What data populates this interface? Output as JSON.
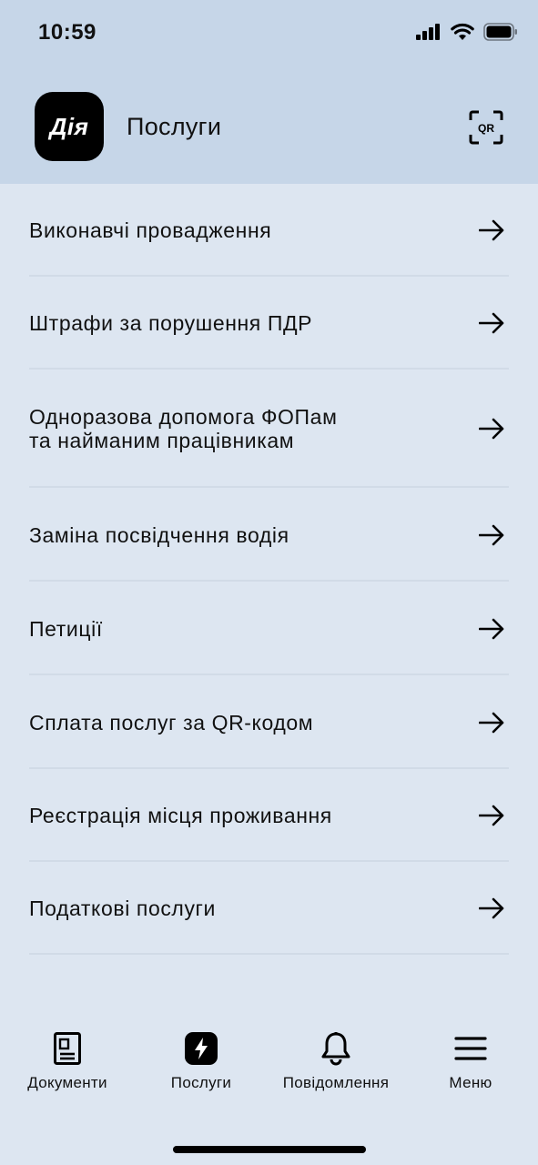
{
  "status_bar": {
    "time": "10:59",
    "icons": [
      "cellular-signal-icon",
      "wifi-icon",
      "battery-icon"
    ]
  },
  "header": {
    "logo_text": "Дія",
    "title": "Послуги",
    "qr_label": "QR"
  },
  "services": [
    {
      "label": "Виконавчі провадження"
    },
    {
      "label": "Штрафи за порушення ПДР"
    },
    {
      "label": "Одноразова допомога ФОПам\nта найманим працівникам"
    },
    {
      "label": "Заміна посвідчення водія"
    },
    {
      "label": "Петиції"
    },
    {
      "label": "Сплата послуг за QR-кодом"
    },
    {
      "label": "Реєстрація місця проживання"
    },
    {
      "label": "Податкові послуги"
    }
  ],
  "tabs": [
    {
      "label": "Документи",
      "icon": "document-icon",
      "active": false
    },
    {
      "label": "Послуги",
      "icon": "lightning-icon",
      "active": true
    },
    {
      "label": "Повідомлення",
      "icon": "bell-icon",
      "active": false
    },
    {
      "label": "Меню",
      "icon": "menu-icon",
      "active": false
    }
  ],
  "colors": {
    "header_bg": "#c6d6e8",
    "page_bg": "#dde6f1",
    "divider": "#d1dbe7",
    "text": "#111111"
  }
}
